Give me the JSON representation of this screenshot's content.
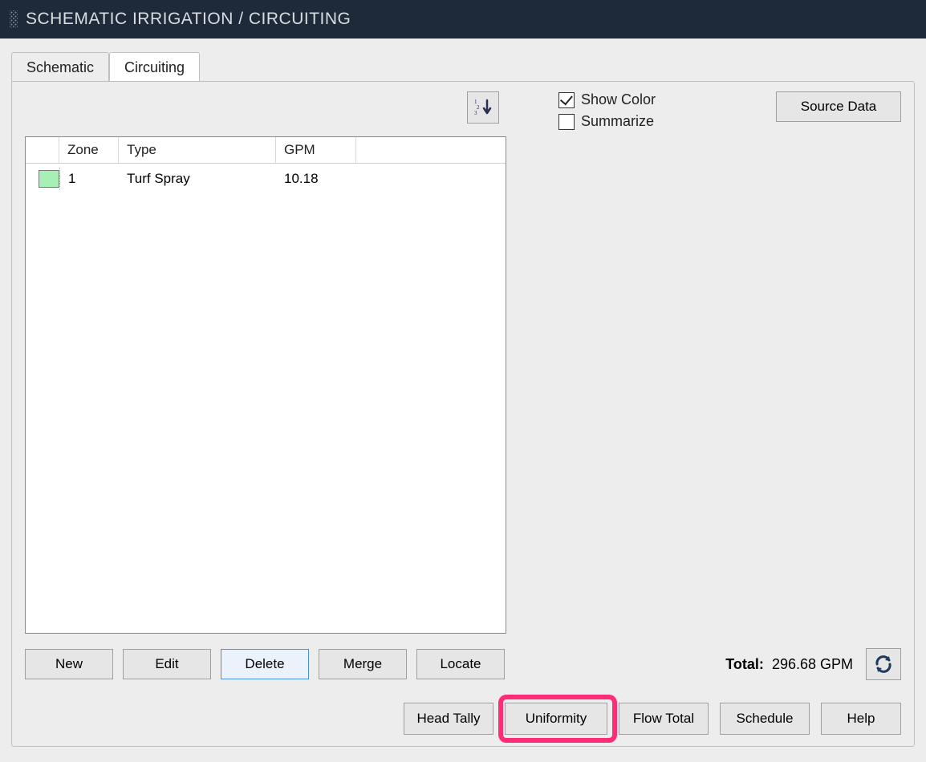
{
  "titlebar": {
    "text": "SCHEMATIC IRRIGATION / CIRCUITING"
  },
  "tabs": {
    "schematic": "Schematic",
    "circuiting": "Circuiting"
  },
  "sort_icon_name": "numeric-sort-icon",
  "checkboxes": {
    "show_color": {
      "label": "Show Color",
      "checked": true
    },
    "summarize": {
      "label": "Summarize",
      "checked": false
    }
  },
  "buttons": {
    "source_data": "Source Data",
    "new": "New",
    "edit": "Edit",
    "delete": "Delete",
    "merge": "Merge",
    "locate": "Locate",
    "head_tally": "Head Tally",
    "uniformity": "Uniformity",
    "flow_total": "Flow Total",
    "schedule": "Schedule",
    "help": "Help"
  },
  "grid": {
    "headers": {
      "zone": "Zone",
      "type": "Type",
      "gpm": "GPM"
    },
    "rows": [
      {
        "color": "#a6f0b7",
        "zone": "1",
        "type": "Turf Spray",
        "gpm": "10.18"
      }
    ]
  },
  "total": {
    "label": "Total:",
    "value": "296.68 GPM"
  }
}
